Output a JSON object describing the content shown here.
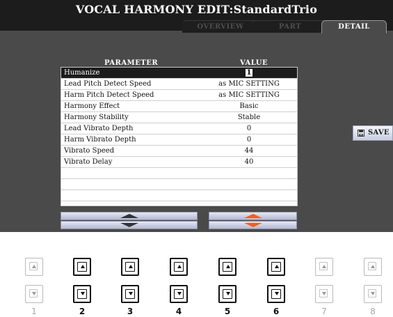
{
  "window": {
    "title": "VOCAL HARMONY EDIT:StandardTrio"
  },
  "tabs": [
    {
      "label": "OVERVIEW",
      "active": false
    },
    {
      "label": "PART",
      "active": false
    },
    {
      "label": "DETAIL",
      "active": true
    }
  ],
  "table": {
    "headers": {
      "parameter": "PARAMETER",
      "value": "VALUE"
    },
    "rows": [
      {
        "name": "Humanize",
        "value": "1",
        "selected": true
      },
      {
        "name": "Lead Pitch Detect Speed",
        "value": "as MIC SETTING"
      },
      {
        "name": "Harm Pitch Detect Speed",
        "value": "as MIC SETTING"
      },
      {
        "name": "Harmony Effect",
        "value": "Basic"
      },
      {
        "name": "Harmony Stability",
        "value": "Stable"
      },
      {
        "name": "Lead Vibrato Depth",
        "value": "0"
      },
      {
        "name": "Harm Vibrato Depth",
        "value": "0"
      },
      {
        "name": "Vibrato Speed",
        "value": "44"
      },
      {
        "name": "Vibrato Delay",
        "value": "40"
      },
      {
        "name": "",
        "value": ""
      },
      {
        "name": "",
        "value": ""
      },
      {
        "name": "",
        "value": ""
      }
    ]
  },
  "scroll_buttons": {
    "parameter_colour": "#333333",
    "value_colour": "#ff5a10"
  },
  "save": {
    "label": "SAVE",
    "icon": "floppy-disk-icon"
  },
  "hardware_buttons": [
    {
      "number": "1",
      "active": false
    },
    {
      "number": "2",
      "active": true
    },
    {
      "number": "3",
      "active": true
    },
    {
      "number": "4",
      "active": true
    },
    {
      "number": "5",
      "active": true
    },
    {
      "number": "6",
      "active": true
    },
    {
      "number": "7",
      "active": false
    },
    {
      "number": "8",
      "active": false
    }
  ]
}
